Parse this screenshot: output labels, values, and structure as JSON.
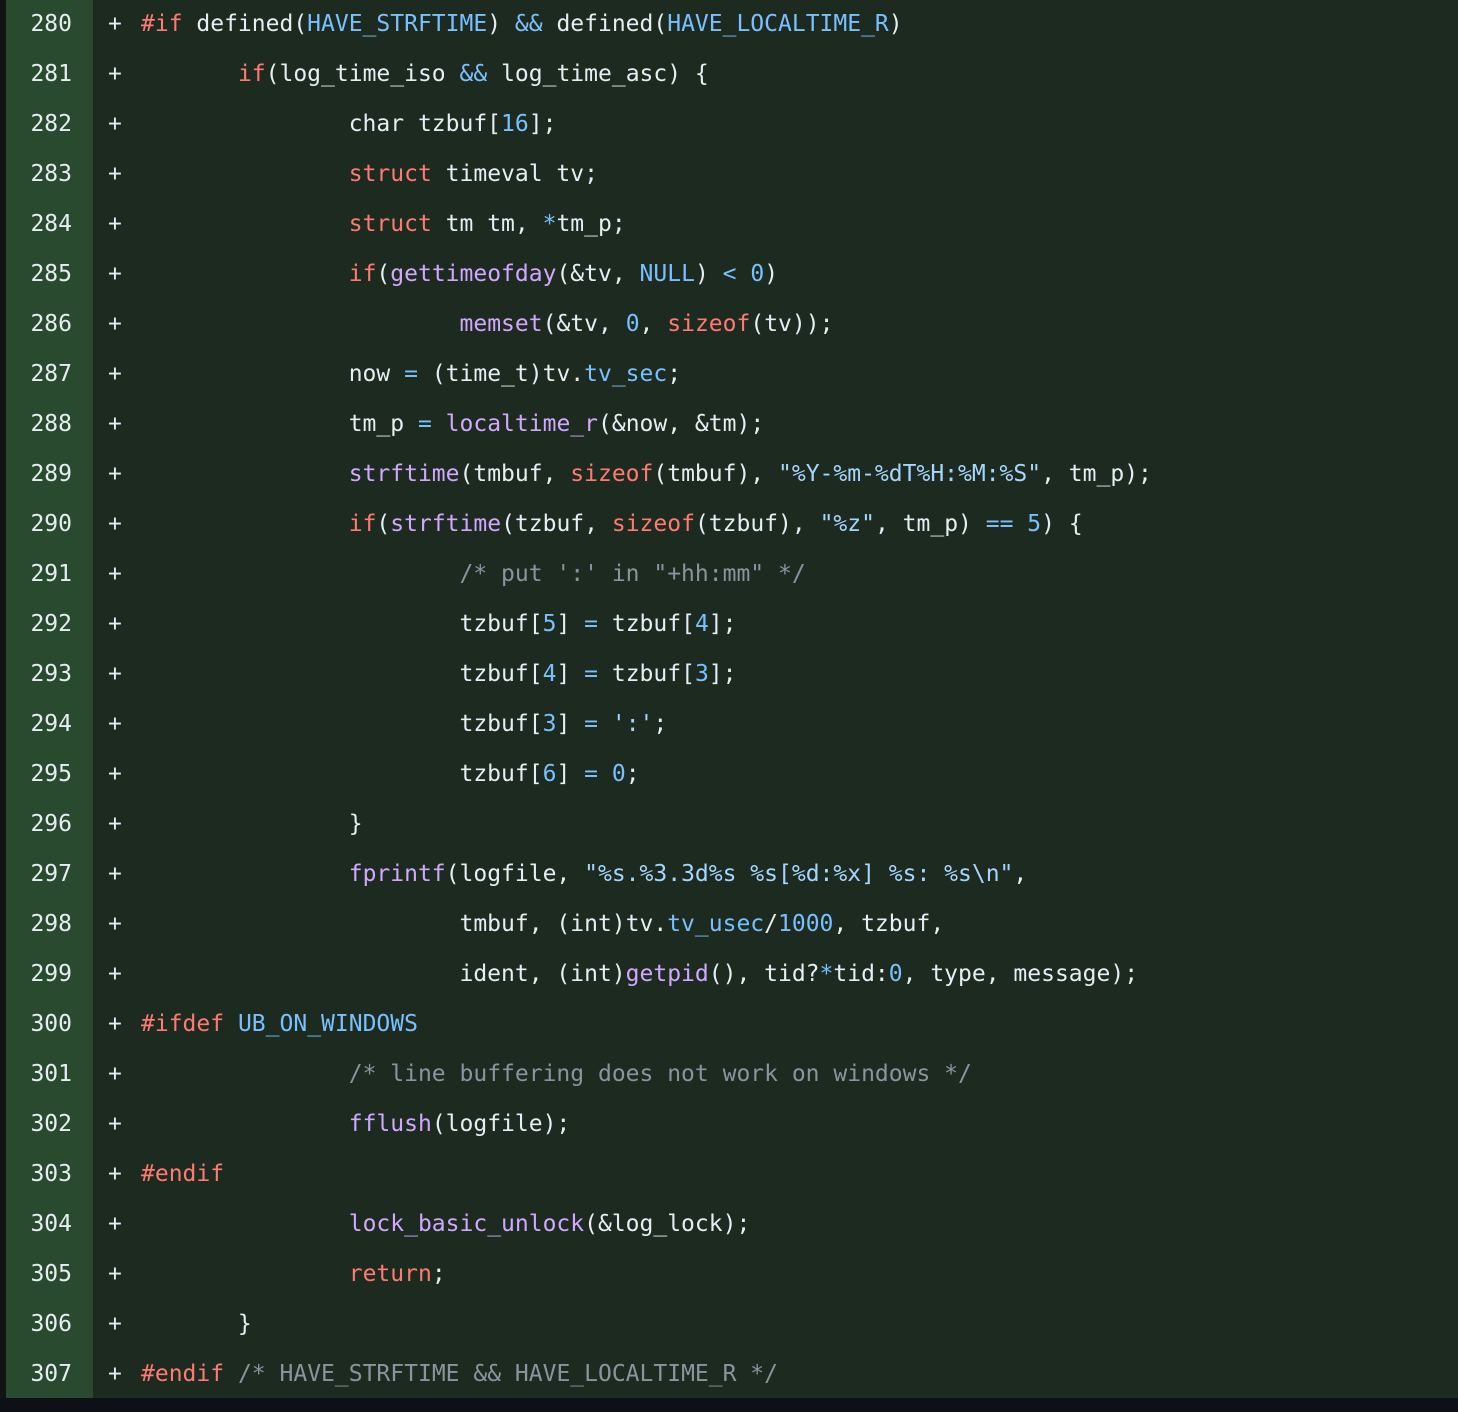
{
  "diff": {
    "marker": "+",
    "lines": [
      {
        "num": "280",
        "tokens": [
          [
            "kw",
            "#if"
          ],
          [
            "p",
            " defined("
          ],
          [
            "c",
            "HAVE_STRFTIME"
          ],
          [
            "p",
            ") "
          ],
          [
            "c",
            "&&"
          ],
          [
            "p",
            " defined("
          ],
          [
            "c",
            "HAVE_LOCALTIME_R"
          ],
          [
            "p",
            ")"
          ]
        ]
      },
      {
        "num": "281",
        "tokens": [
          [
            "p",
            "       "
          ],
          [
            "kw",
            "if"
          ],
          [
            "p",
            "(log_time_iso "
          ],
          [
            "c",
            "&&"
          ],
          [
            "p",
            " log_time_asc) {"
          ]
        ]
      },
      {
        "num": "282",
        "tokens": [
          [
            "p",
            "               char tzbuf["
          ],
          [
            "c",
            "16"
          ],
          [
            "p",
            "];"
          ]
        ]
      },
      {
        "num": "283",
        "tokens": [
          [
            "p",
            "               "
          ],
          [
            "kw",
            "struct"
          ],
          [
            "p",
            " timeval tv;"
          ]
        ]
      },
      {
        "num": "284",
        "tokens": [
          [
            "p",
            "               "
          ],
          [
            "kw",
            "struct"
          ],
          [
            "p",
            " tm tm, "
          ],
          [
            "c",
            "*"
          ],
          [
            "p",
            "tm_p;"
          ]
        ]
      },
      {
        "num": "285",
        "tokens": [
          [
            "p",
            "               "
          ],
          [
            "kw",
            "if"
          ],
          [
            "p",
            "("
          ],
          [
            "fn",
            "gettimeofday"
          ],
          [
            "p",
            "(&tv, "
          ],
          [
            "c",
            "NULL"
          ],
          [
            "p",
            ") "
          ],
          [
            "c",
            "<"
          ],
          [
            "p",
            " "
          ],
          [
            "c",
            "0"
          ],
          [
            "p",
            ")"
          ]
        ]
      },
      {
        "num": "286",
        "tokens": [
          [
            "p",
            "                       "
          ],
          [
            "fn",
            "memset"
          ],
          [
            "p",
            "(&tv, "
          ],
          [
            "c",
            "0"
          ],
          [
            "p",
            ", "
          ],
          [
            "kw",
            "sizeof"
          ],
          [
            "p",
            "(tv));"
          ]
        ]
      },
      {
        "num": "287",
        "tokens": [
          [
            "p",
            "               now "
          ],
          [
            "c",
            "="
          ],
          [
            "p",
            " (time_t)tv."
          ],
          [
            "c",
            "tv_sec"
          ],
          [
            "p",
            ";"
          ]
        ]
      },
      {
        "num": "288",
        "tokens": [
          [
            "p",
            "               tm_p "
          ],
          [
            "c",
            "="
          ],
          [
            "p",
            " "
          ],
          [
            "fn",
            "localtime_r"
          ],
          [
            "p",
            "(&now, &tm);"
          ]
        ]
      },
      {
        "num": "289",
        "tokens": [
          [
            "p",
            "               "
          ],
          [
            "fn",
            "strftime"
          ],
          [
            "p",
            "(tmbuf, "
          ],
          [
            "kw",
            "sizeof"
          ],
          [
            "p",
            "(tmbuf), "
          ],
          [
            "s",
            "\"%Y-%m-%dT%H:%M:%S\""
          ],
          [
            "p",
            ", tm_p);"
          ]
        ]
      },
      {
        "num": "290",
        "tokens": [
          [
            "p",
            "               "
          ],
          [
            "kw",
            "if"
          ],
          [
            "p",
            "("
          ],
          [
            "fn",
            "strftime"
          ],
          [
            "p",
            "(tzbuf, "
          ],
          [
            "kw",
            "sizeof"
          ],
          [
            "p",
            "(tzbuf), "
          ],
          [
            "s",
            "\"%z\""
          ],
          [
            "p",
            ", tm_p) "
          ],
          [
            "c",
            "=="
          ],
          [
            "p",
            " "
          ],
          [
            "c",
            "5"
          ],
          [
            "p",
            ") {"
          ]
        ]
      },
      {
        "num": "291",
        "tokens": [
          [
            "p",
            "                       "
          ],
          [
            "com",
            "/* put ':' in \"+hh:mm\" */"
          ]
        ]
      },
      {
        "num": "292",
        "tokens": [
          [
            "p",
            "                       tzbuf["
          ],
          [
            "c",
            "5"
          ],
          [
            "p",
            "] "
          ],
          [
            "c",
            "="
          ],
          [
            "p",
            " tzbuf["
          ],
          [
            "c",
            "4"
          ],
          [
            "p",
            "];"
          ]
        ]
      },
      {
        "num": "293",
        "tokens": [
          [
            "p",
            "                       tzbuf["
          ],
          [
            "c",
            "4"
          ],
          [
            "p",
            "] "
          ],
          [
            "c",
            "="
          ],
          [
            "p",
            " tzbuf["
          ],
          [
            "c",
            "3"
          ],
          [
            "p",
            "];"
          ]
        ]
      },
      {
        "num": "294",
        "tokens": [
          [
            "p",
            "                       tzbuf["
          ],
          [
            "c",
            "3"
          ],
          [
            "p",
            "] "
          ],
          [
            "c",
            "="
          ],
          [
            "p",
            " "
          ],
          [
            "s",
            "':'"
          ],
          [
            "p",
            ";"
          ]
        ]
      },
      {
        "num": "295",
        "tokens": [
          [
            "p",
            "                       tzbuf["
          ],
          [
            "c",
            "6"
          ],
          [
            "p",
            "] "
          ],
          [
            "c",
            "="
          ],
          [
            "p",
            " "
          ],
          [
            "c",
            "0"
          ],
          [
            "p",
            ";"
          ]
        ]
      },
      {
        "num": "296",
        "tokens": [
          [
            "p",
            "               }"
          ]
        ]
      },
      {
        "num": "297",
        "tokens": [
          [
            "p",
            "               "
          ],
          [
            "fn",
            "fprintf"
          ],
          [
            "p",
            "(logfile, "
          ],
          [
            "s",
            "\"%s.%3.3d%s %s[%d:%x] %s: %s\\n\""
          ],
          [
            "p",
            ","
          ]
        ]
      },
      {
        "num": "298",
        "tokens": [
          [
            "p",
            "                       tmbuf, (int)tv."
          ],
          [
            "c",
            "tv_usec"
          ],
          [
            "p",
            "/"
          ],
          [
            "c",
            "1000"
          ],
          [
            "p",
            ", tzbuf,"
          ]
        ]
      },
      {
        "num": "299",
        "tokens": [
          [
            "p",
            "                       ident, (int)"
          ],
          [
            "fn",
            "getpid"
          ],
          [
            "p",
            "(), tid?"
          ],
          [
            "c",
            "*"
          ],
          [
            "p",
            "tid:"
          ],
          [
            "c",
            "0"
          ],
          [
            "p",
            ", type, message);"
          ]
        ]
      },
      {
        "num": "300",
        "tokens": [
          [
            "kw",
            "#ifdef"
          ],
          [
            "p",
            " "
          ],
          [
            "c",
            "UB_ON_WINDOWS"
          ]
        ]
      },
      {
        "num": "301",
        "tokens": [
          [
            "p",
            "               "
          ],
          [
            "com",
            "/* line buffering does not work on windows */"
          ]
        ]
      },
      {
        "num": "302",
        "tokens": [
          [
            "p",
            "               "
          ],
          [
            "fn",
            "fflush"
          ],
          [
            "p",
            "(logfile);"
          ]
        ]
      },
      {
        "num": "303",
        "tokens": [
          [
            "kw",
            "#endif"
          ]
        ]
      },
      {
        "num": "304",
        "tokens": [
          [
            "p",
            "               "
          ],
          [
            "fn",
            "lock_basic_unlock"
          ],
          [
            "p",
            "(&log_lock);"
          ]
        ]
      },
      {
        "num": "305",
        "tokens": [
          [
            "p",
            "               "
          ],
          [
            "kw",
            "return"
          ],
          [
            "p",
            ";"
          ]
        ]
      },
      {
        "num": "306",
        "tokens": [
          [
            "p",
            "       }"
          ]
        ]
      },
      {
        "num": "307",
        "tokens": [
          [
            "kw",
            "#endif"
          ],
          [
            "p",
            " "
          ],
          [
            "com",
            "/* HAVE_STRFTIME && HAVE_LOCALTIME_R */"
          ]
        ]
      }
    ]
  }
}
